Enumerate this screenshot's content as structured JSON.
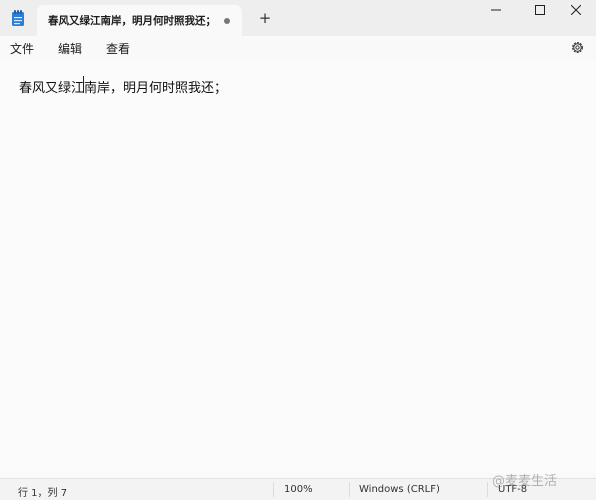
{
  "tab": {
    "title": "春风又绿江南岸，明月何时照我还；",
    "new_tab": "+"
  },
  "menu": {
    "file": "文件",
    "edit": "编辑",
    "view": "查看"
  },
  "editor": {
    "text": "春风又绿江南岸，明月何时照我还；"
  },
  "status": {
    "position": "行 1，列 7",
    "zoom": "100%",
    "line_ending": "Windows (CRLF)",
    "encoding": "UTF-8"
  },
  "watermark": "@麦麦生活",
  "colors": {
    "titlebar": "#eeeeee",
    "editor": "#fbfbfb",
    "accent": "#1e73c9"
  }
}
